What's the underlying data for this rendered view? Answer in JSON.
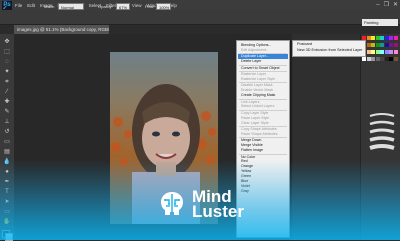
{
  "app": {
    "logo": "Ps"
  },
  "menubar": {
    "items": [
      "File",
      "Edit",
      "Image",
      "Layer",
      "Type",
      "Select",
      "Filter",
      "3D",
      "View",
      "Window",
      "Help"
    ],
    "window_controls": [
      "–",
      "❐",
      "✕"
    ]
  },
  "options_bar": {
    "mode_label": "Mode:",
    "mode_value": "Normal",
    "opacity_label": "Opacity:",
    "opacity_value": "67%",
    "flow_label": "Flow:",
    "flow_value": "100%"
  },
  "workspace": {
    "value": "Painting"
  },
  "document": {
    "tab": "images.jpg @ 51.1% (Background copy, RGB/8) *"
  },
  "context_menu": {
    "items": [
      {
        "label": "Blending Options...",
        "state": "normal"
      },
      {
        "label": "Edit Adjustment...",
        "state": "disabled"
      },
      {
        "sep": true
      },
      {
        "label": "Duplicate Layer...",
        "state": "highlight"
      },
      {
        "label": "Delete Layer",
        "state": "normal"
      },
      {
        "sep": true
      },
      {
        "label": "Convert to Smart Object",
        "state": "normal"
      },
      {
        "sep": true
      },
      {
        "label": "Rasterize Layer",
        "state": "disabled"
      },
      {
        "label": "Rasterize Layer Style",
        "state": "disabled"
      },
      {
        "sep": true
      },
      {
        "label": "Disable Layer Mask",
        "state": "disabled"
      },
      {
        "label": "Enable Vector Mask",
        "state": "disabled"
      },
      {
        "label": "Create Clipping Mask",
        "state": "normal"
      },
      {
        "sep": true
      },
      {
        "label": "Link Layers",
        "state": "disabled"
      },
      {
        "label": "Select Linked Layers",
        "state": "disabled"
      },
      {
        "sep": true
      },
      {
        "label": "Copy Layer Style",
        "state": "disabled"
      },
      {
        "label": "Paste Layer Style",
        "state": "disabled"
      },
      {
        "label": "Clear Layer Style",
        "state": "disabled"
      },
      {
        "sep": true
      },
      {
        "label": "Copy Shape Attributes",
        "state": "disabled"
      },
      {
        "label": "Paste Shape Attributes",
        "state": "disabled"
      },
      {
        "sep": true
      },
      {
        "label": "Merge Down",
        "state": "normal"
      },
      {
        "label": "Merge Visible",
        "state": "normal"
      },
      {
        "label": "Flatten Image",
        "state": "normal"
      },
      {
        "sep": true
      },
      {
        "label": "No Color",
        "state": "normal"
      },
      {
        "label": "Red",
        "state": "normal"
      },
      {
        "label": "Orange",
        "state": "normal"
      },
      {
        "label": "Yellow",
        "state": "normal"
      },
      {
        "label": "Green",
        "state": "normal"
      },
      {
        "label": "Blue",
        "state": "normal"
      },
      {
        "label": "Violet",
        "state": "normal"
      },
      {
        "label": "Gray",
        "state": "normal"
      }
    ]
  },
  "submenu": {
    "items": [
      "Postcard",
      "New 3D Extrusion from Selected Layer"
    ]
  },
  "brand": {
    "line1": "Mind",
    "line2": "Luster"
  },
  "colors": {
    "accent": "#3a84d8",
    "brand_blue": "#1aaee8"
  }
}
